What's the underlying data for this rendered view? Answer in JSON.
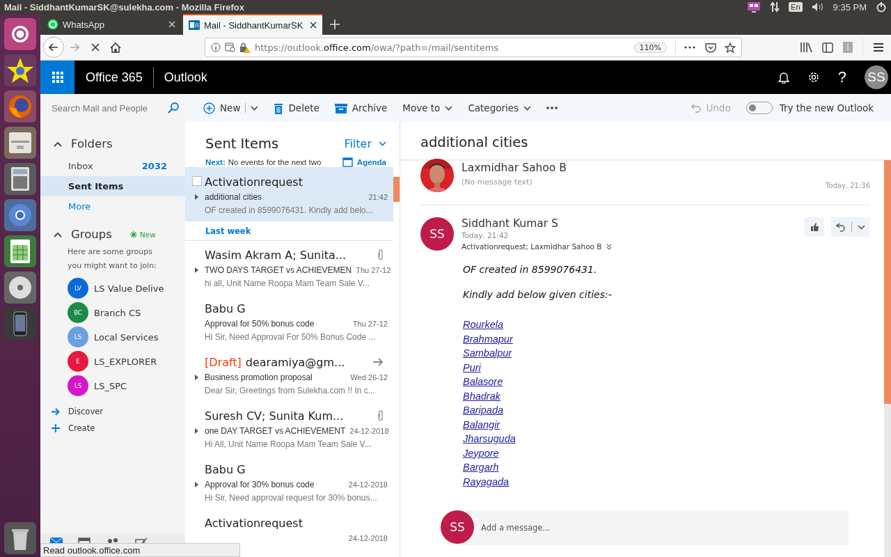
{
  "window": {
    "title": "Mail - SiddhantKumarSK@sulekha.com - Mozilla Firefox"
  },
  "system_tray": {
    "keyboard": "En",
    "time": "9:35 PM"
  },
  "tabs": [
    {
      "label": "WhatsApp",
      "kind": "whatsapp",
      "selected": false
    },
    {
      "label": "Mail - SiddhantKumarSK",
      "kind": "outlook",
      "selected": true
    }
  ],
  "address_bar": {
    "url": "https://outlook.**office.com**/owa/?path=/mail/sentitems",
    "zoom": "110%"
  },
  "office_header": {
    "suite": "Office 365",
    "app": "Outlook",
    "help": "?",
    "avatar": "SS"
  },
  "search": {
    "placeholder": "Search Mail and People"
  },
  "toolbar": {
    "actions": [
      {
        "label": "New",
        "kind": "new"
      },
      {
        "label": "Delete",
        "kind": "delete"
      },
      {
        "label": "Archive",
        "kind": "archive"
      },
      {
        "label": "Move to",
        "kind": "menu"
      },
      {
        "label": "Categories",
        "kind": "menu"
      },
      {
        "kind": "more"
      }
    ],
    "undo": {
      "label": "Undo",
      "disabled": true
    },
    "new_outlook": {
      "label": "Try the new Outlook",
      "on": false
    }
  },
  "navigation": {
    "folders": {
      "heading": "Folders",
      "expanded": true,
      "items": [
        {
          "label": "Inbox",
          "count": "2032",
          "kind": "folder",
          "selected": false
        },
        {
          "label": "Sent Items",
          "kind": "folder",
          "selected": true
        },
        {
          "label": "More",
          "kind": "link",
          "selected": false
        }
      ]
    },
    "groups": {
      "heading": "Groups",
      "expanded": true,
      "badge": "New",
      "hint": "Here are some groups you might want to join:",
      "items": [
        {
          "initials": "LV",
          "name": "LS Value Delive",
          "color": "#0b6bd6"
        },
        {
          "initials": "BC",
          "name": "Branch CS",
          "color": "#1f8a46"
        },
        {
          "initials": "LS",
          "name": "Local Services",
          "color": "#6a9fe0"
        },
        {
          "initials": "E",
          "name": "LS_EXPLORER",
          "color": "#e8183f"
        },
        {
          "initials": "LS",
          "name": "LS_SPC",
          "color": "#d417c8"
        }
      ]
    },
    "actions": [
      {
        "label": "Discover",
        "kind": "discover"
      },
      {
        "label": "Create",
        "kind": "create"
      }
    ]
  },
  "message_list": {
    "title": "Sent Items",
    "filter": "Filter",
    "next_label": "Next:",
    "next_text": "No events for the next two",
    "agenda": "Agenda",
    "items": [
      {
        "kind": "message",
        "sender": "Activationrequest",
        "subject": "additional cities",
        "date": "21:42",
        "preview": "OF created in 8599076431. Kindly add belo...",
        "thread": true,
        "attachment": false,
        "forwarded": false,
        "selected": true
      },
      {
        "kind": "header",
        "label": "Last week"
      },
      {
        "kind": "message",
        "sender": "Wasim Akram A; Sunita...",
        "subject": "TWO DAYS TARGET vs ACHIEVEMEN",
        "date": "Thu 27-12",
        "preview": "hi all, Unit Name Roopa Mam Team Sale V...",
        "thread": true,
        "attachment": true,
        "forwarded": false,
        "selected": false
      },
      {
        "kind": "message",
        "sender": "Babu G",
        "subject": "Approval for 50% bonus code",
        "date": "Thu 27-12",
        "preview": "Hi Sir, Need Approval For 50% Bonus Code ...",
        "thread": false,
        "attachment": false,
        "forwarded": false,
        "selected": false
      },
      {
        "kind": "message",
        "draft_label": "[Draft]",
        "sender": "dearamiya@gm...",
        "subject": "Business promotion proposal",
        "date": "Wed 26-12",
        "preview": "Dear Sir, Greetings from Sulekha.com !! In c...",
        "thread": true,
        "attachment": false,
        "forwarded": true,
        "selected": false
      },
      {
        "kind": "message",
        "sender": "Suresh CV; Sunita Kum...",
        "subject": "one DAY TARGET vs ACHIEVEMENT",
        "date": "24-12-2018",
        "preview": "Hi All, Unit Name Roopa Mam Team Sale V...",
        "thread": true,
        "attachment": true,
        "forwarded": false,
        "selected": false
      },
      {
        "kind": "message",
        "sender": "Babu G",
        "subject": "Approval for 30% bonus code",
        "date": "24-12-2018",
        "preview": "Hi Sir, Need approval request for 30% bonus...",
        "thread": true,
        "attachment": false,
        "forwarded": false,
        "selected": false
      },
      {
        "kind": "message",
        "sender": "Activationrequest",
        "date": "24-12-2018",
        "thread": false,
        "attachment": false,
        "forwarded": false,
        "selected": false
      }
    ]
  },
  "reading_pane": {
    "subject": "additional cities",
    "thread": [
      {
        "kind": "collapsed",
        "sender": "Laxmidhar Sahoo B",
        "preview": "(No message text)",
        "time": "Today, 21:36"
      },
      {
        "kind": "expanded",
        "sender": "Siddhant Kumar S",
        "initials": "SS",
        "time": "Today, 21:42",
        "recipients": "Activationrequest; Laxmidhar Sahoo B",
        "body": [
          "OF created in 8599076431.",
          "Kindly add below given cities:-"
        ],
        "cities": [
          "Rourkela",
          "Brahmapur",
          "Sambalpur",
          "Puri",
          "Balasore",
          "Bhadrak",
          "Baripada",
          "Balangir",
          "Jharsuguda",
          "Jeypore",
          "Bargarh",
          "Rayagada"
        ]
      }
    ],
    "reply": {
      "initials": "SS",
      "placeholder": "Add a message..."
    }
  },
  "status_tooltip": "Read outlook.office.com"
}
